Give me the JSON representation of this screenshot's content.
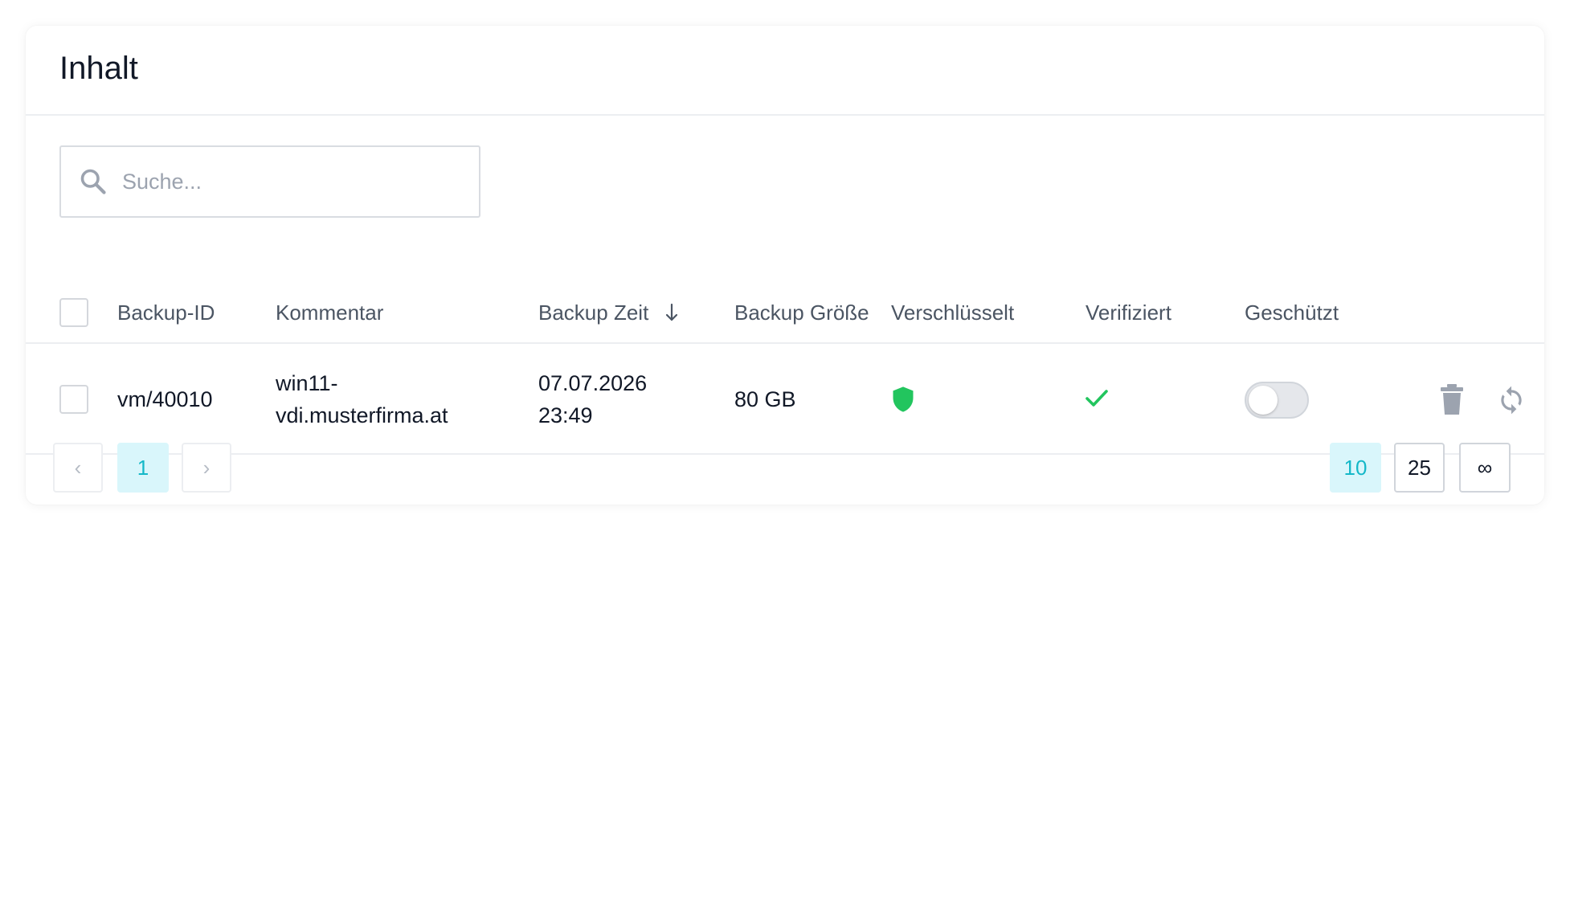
{
  "card": {
    "title": "Inhalt"
  },
  "search": {
    "placeholder": "Suche..."
  },
  "table": {
    "columns": [
      "Backup-ID",
      "Kommentar",
      "Backup Zeit",
      "Backup Größe",
      "Verschlüsselt",
      "Verifiziert",
      "Geschützt"
    ],
    "sort": {
      "column": "Backup Zeit",
      "direction": "descending",
      "icon": "arrow-down-icon"
    },
    "rows": [
      {
        "selected": false,
        "backup_id": "vm/40010",
        "comment_line1": "win11-",
        "comment_line2": "vdi.musterfirma.at",
        "time_line1": "07.07.2026",
        "time_line2": "23:49",
        "size": "80 GB",
        "encrypted_icon": "shield-icon",
        "verified_icon": "checkmark-icon",
        "protected": false,
        "actions": [
          "trash-icon",
          "refresh-icon"
        ]
      }
    ]
  },
  "pagination": {
    "prev_icon": "chevron-left-icon",
    "current_page": "1",
    "next_icon": "chevron-right-icon",
    "page_sizes": [
      "10",
      "25",
      "∞"
    ],
    "active_page_size": "10"
  },
  "colors": {
    "accent": "#14b8c8",
    "accent_bg": "#d9f6fb",
    "success": "#22c55e",
    "muted_icon": "#9ca3af"
  }
}
